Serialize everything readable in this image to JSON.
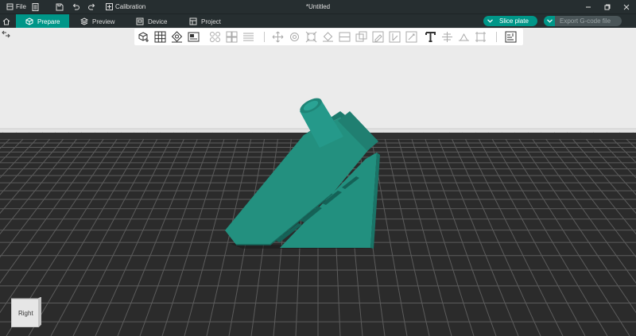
{
  "titlebar": {
    "file_label": "File",
    "calibration_label": "Calibration",
    "document_title": "*Untitled"
  },
  "tabs": {
    "prepare": "Prepare",
    "preview": "Preview",
    "device": "Device",
    "project": "Project"
  },
  "actions": {
    "slice_label": "Slice plate",
    "export_label": "Export G-code file"
  },
  "viewcube": {
    "face_label": "Right"
  },
  "colors": {
    "accent": "#009688",
    "model": "#1e8a7c",
    "bed": "#2b2b2b",
    "background": "#ebebeb"
  },
  "toolbar_icons": [
    "add-object-icon",
    "arrange-grid-icon",
    "orient-icon",
    "plate-icon",
    "auto-arrange-icon",
    "split-parts-icon",
    "layers-icon",
    "move-icon",
    "rotate-icon",
    "scale-icon",
    "lay-on-face-icon",
    "cut-icon",
    "boolean-icon",
    "support-paint-icon",
    "seam-paint-icon",
    "color-paint-icon",
    "text-icon",
    "measure-icon",
    "emboss-icon",
    "assembly-icon",
    "variable-layer-icon"
  ]
}
